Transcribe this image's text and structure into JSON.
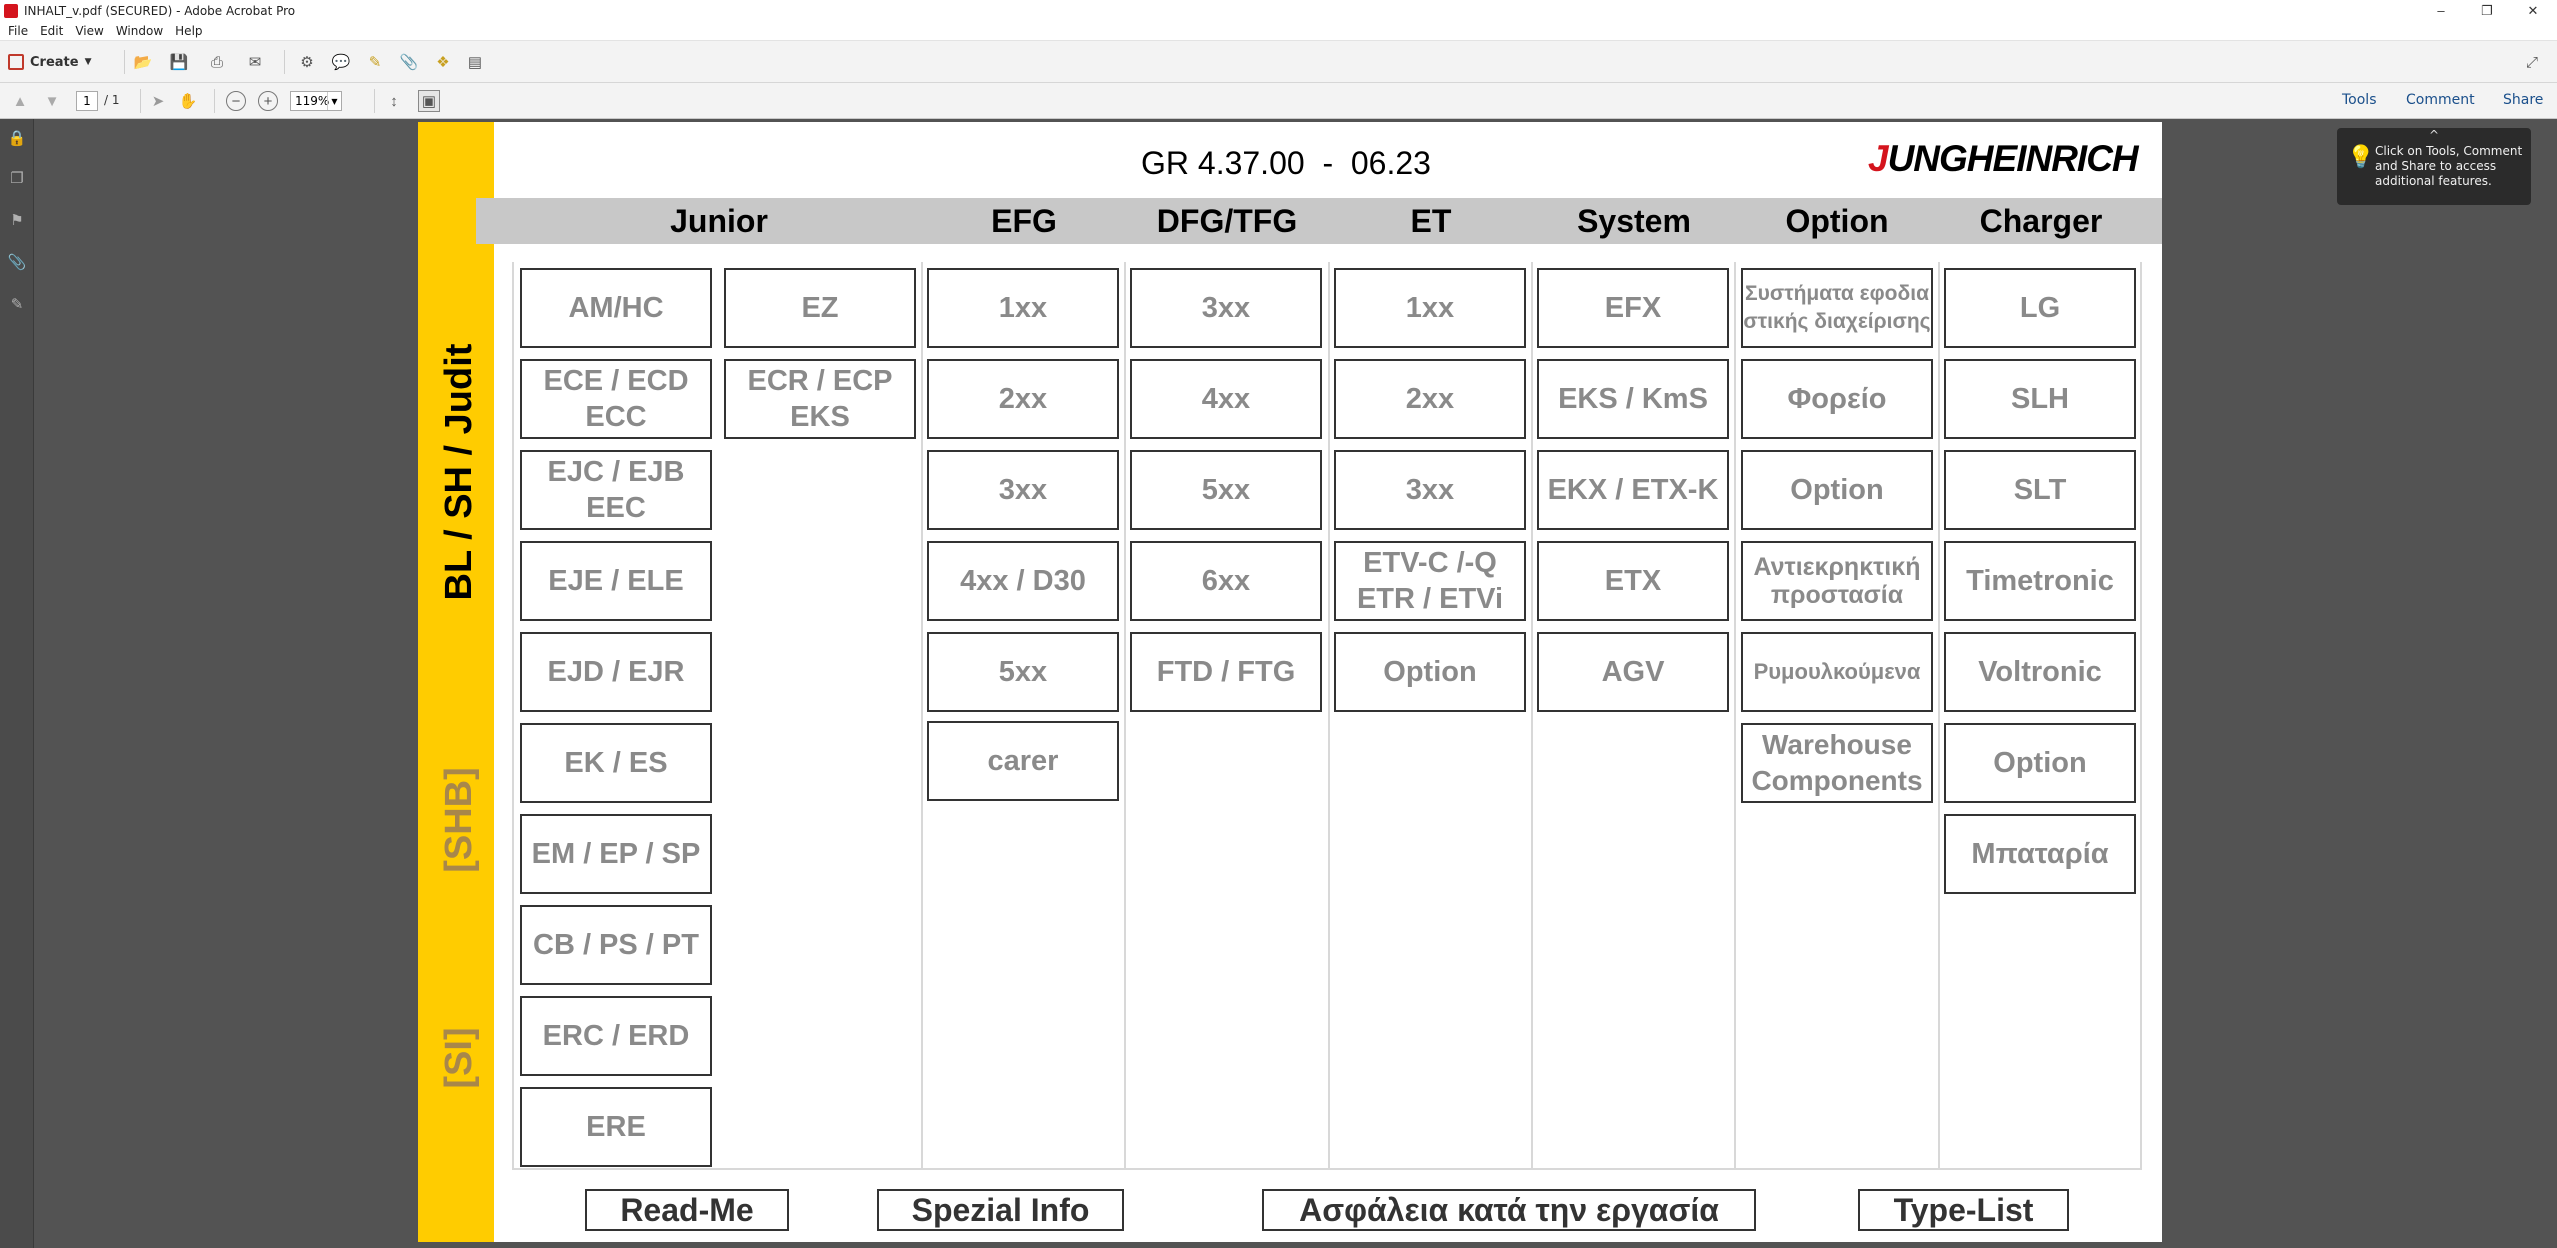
{
  "window": {
    "title": "INHALT_v.pdf (SECURED) - Adobe Acrobat Pro"
  },
  "menu": [
    "File",
    "Edit",
    "View",
    "Window",
    "Help"
  ],
  "toolbar": {
    "create_label": "Create",
    "page_current": "1",
    "page_total": "/ 1",
    "zoom": "119%",
    "tools_label": "Tools",
    "comment_label": "Comment",
    "share_label": "Share"
  },
  "tooltip": {
    "text": "Click on Tools, Comment and Share to access additional features."
  },
  "document": {
    "header": "GR 4.37.00  -  06.23",
    "logo": {
      "first": "J",
      "rest": "UNGHEINRICH"
    },
    "side_labels": [
      "BL / SH / Judit",
      "[SHB]",
      "[SI]"
    ],
    "columns": [
      "Junior",
      "EFG",
      "DFG/TFG",
      "ET",
      "System",
      "Option",
      "Charger"
    ],
    "junior_col1": [
      "AM/HC",
      "ECE / ECD ECC",
      "EJC / EJB EEC",
      "EJE / ELE",
      "EJD / EJR",
      "EK / ES",
      "EM / EP / SP",
      "CB / PS / PT",
      "ERC / ERD",
      "ERE"
    ],
    "junior_col2": [
      "EZ",
      "ECR / ECP EKS"
    ],
    "efg": [
      "1xx",
      "2xx",
      "3xx",
      "4xx / D30",
      "5xx",
      "carer"
    ],
    "dfg": [
      "3xx",
      "4xx",
      "5xx",
      "6xx",
      "FTD / FTG"
    ],
    "et": [
      "1xx",
      "2xx",
      "3xx",
      "ETV-C /-Q ETR / ETVi",
      "Option"
    ],
    "system": [
      "EFX",
      "EKS / KmS",
      "EKX / ETX-K",
      "ETX",
      "AGV"
    ],
    "option": [
      "Συστήματα εφοδια στικής διαχείρισης",
      "Φορείο",
      "Option",
      "Αντιεκρηκτική προστασία",
      "Ρυμουλκούμενα",
      "Warehouse Components"
    ],
    "charger": [
      "LG",
      "SLH",
      "SLT",
      "Timetronic",
      "Voltronic",
      "Option",
      "Μπαταρία"
    ],
    "bottom_buttons": [
      "Read-Me",
      "Spezial Info",
      "Ασφάλεια κατά την εργασία",
      "Type-List"
    ]
  }
}
